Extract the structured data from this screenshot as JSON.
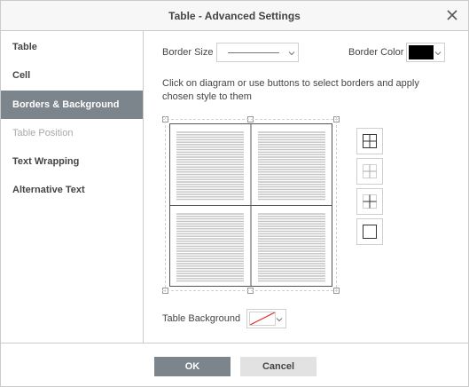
{
  "dialog": {
    "title": "Table - Advanced Settings",
    "close_icon": "close-icon"
  },
  "sidebar": {
    "items": [
      {
        "label": "Table",
        "state": "normal"
      },
      {
        "label": "Cell",
        "state": "normal"
      },
      {
        "label": "Borders & Background",
        "state": "active"
      },
      {
        "label": "Table Position",
        "state": "disabled"
      },
      {
        "label": "Text Wrapping",
        "state": "normal"
      },
      {
        "label": "Alternative Text",
        "state": "normal"
      }
    ]
  },
  "borders": {
    "border_size_label": "Border Size",
    "border_color_label": "Border Color",
    "border_color_value": "#000000",
    "instructions": "Click on diagram or use buttons to select borders and apply chosen style to them",
    "table_background_label": "Table Background",
    "table_background_value": "no-fill",
    "buttons": [
      {
        "icon": "all-borders-icon"
      },
      {
        "icon": "inner-borders-icon"
      },
      {
        "icon": "inner-borders-bold-icon"
      },
      {
        "icon": "outer-border-icon"
      }
    ]
  },
  "footer": {
    "ok_label": "OK",
    "cancel_label": "Cancel"
  },
  "colors": {
    "accent": "#7d858c",
    "border": "#cbcbcb",
    "text": "#444444"
  }
}
